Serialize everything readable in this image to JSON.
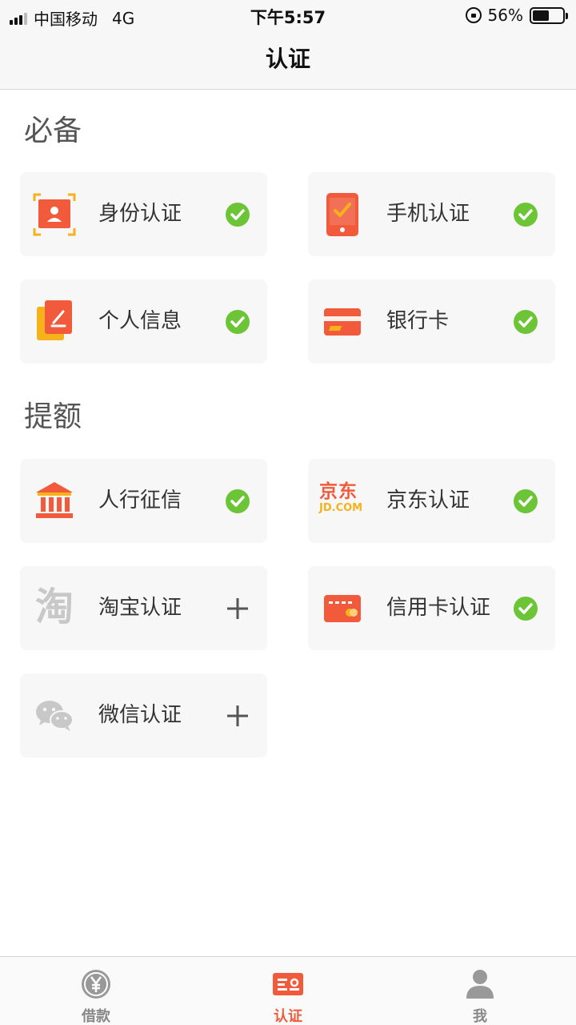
{
  "status_bar": {
    "carrier": "中国移动",
    "network": "4G",
    "time": "下午5:57",
    "battery_percent": "56%",
    "battery_level": 0.56
  },
  "header": {
    "title": "认证"
  },
  "sections": [
    {
      "title": "必备",
      "items": [
        {
          "label": "身份认证",
          "icon": "id-card-icon",
          "status": "verified"
        },
        {
          "label": "手机认证",
          "icon": "phone-check-icon",
          "status": "verified"
        },
        {
          "label": "个人信息",
          "icon": "personal-info-icon",
          "status": "verified"
        },
        {
          "label": "银行卡",
          "icon": "bank-card-icon",
          "status": "verified"
        }
      ]
    },
    {
      "title": "提额",
      "items": [
        {
          "label": "人行征信",
          "icon": "bank-building-icon",
          "status": "verified"
        },
        {
          "label": "京东认证",
          "icon": "jd-logo-icon",
          "status": "verified",
          "logo_text_top": "京东",
          "logo_text_bottom": "JD.COM"
        },
        {
          "label": "淘宝认证",
          "icon": "taobao-logo-icon",
          "status": "add",
          "logo_text": "淘"
        },
        {
          "label": "信用卡认证",
          "icon": "credit-card-icon",
          "status": "verified"
        },
        {
          "label": "微信认证",
          "icon": "wechat-icon",
          "status": "add"
        }
      ]
    }
  ],
  "tabbar": {
    "items": [
      {
        "label": "借款",
        "icon": "yen-coin-icon",
        "active": false
      },
      {
        "label": "认证",
        "icon": "certificate-icon",
        "active": true
      },
      {
        "label": "我",
        "icon": "user-icon",
        "active": false
      }
    ]
  },
  "colors": {
    "accent": "#f15a3a",
    "check_green": "#6cc536",
    "card_bg": "#f7f7f7",
    "inactive_tab": "#888888"
  }
}
